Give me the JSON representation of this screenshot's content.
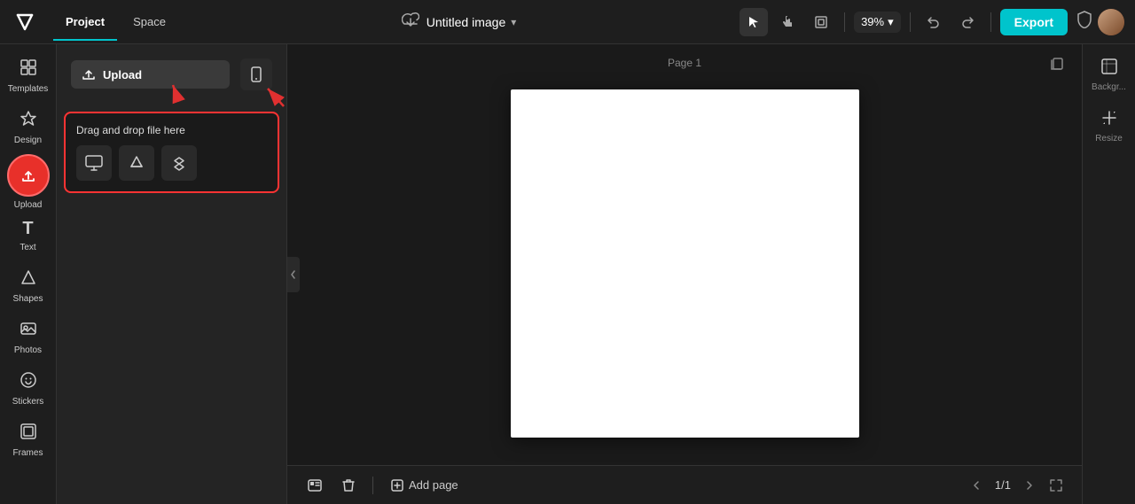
{
  "topbar": {
    "logo": "✕",
    "tabs": [
      {
        "label": "Project",
        "active": true
      },
      {
        "label": "Space",
        "active": false
      }
    ],
    "cloud_icon": "☁",
    "title": "Untitled image",
    "chevron": "▾",
    "tools": [
      {
        "name": "select",
        "icon": "↖",
        "active": true
      },
      {
        "name": "hand",
        "icon": "✋",
        "active": false
      },
      {
        "name": "frame",
        "icon": "⬜",
        "active": false
      }
    ],
    "zoom": "39%",
    "zoom_chevron": "▾",
    "undo_icon": "↩",
    "redo_icon": "↪",
    "export_label": "Export",
    "shield_icon": "🛡"
  },
  "sidebar": {
    "items": [
      {
        "label": "Templates",
        "icon": "⊞"
      },
      {
        "label": "Design",
        "icon": "✦"
      },
      {
        "label": "Upload",
        "icon": "↑",
        "active": true
      },
      {
        "label": "Text",
        "icon": "T"
      },
      {
        "label": "Shapes",
        "icon": "◇"
      },
      {
        "label": "Photos",
        "icon": "🖼"
      },
      {
        "label": "Stickers",
        "icon": "☺"
      },
      {
        "label": "Frames",
        "icon": "⬚"
      }
    ]
  },
  "panel": {
    "upload_btn_label": "Upload",
    "upload_icon": "↑",
    "phone_icon": "📱",
    "drag_drop_label": "Drag and drop file here",
    "sources": [
      {
        "name": "computer",
        "icon": "🖥"
      },
      {
        "name": "google-drive",
        "icon": "△"
      },
      {
        "name": "dropbox",
        "icon": "❑"
      }
    ]
  },
  "canvas": {
    "page_label": "Page 1",
    "page_icon": "⎘"
  },
  "bottom_bar": {
    "camera_icon": "⊡",
    "trash_icon": "🗑",
    "add_page_icon": "⊞",
    "add_page_label": "Add page",
    "page_prev": "‹",
    "page_counter": "1/1",
    "page_next": "›",
    "fit_icon": "⊡"
  },
  "right_sidebar": {
    "items": [
      {
        "label": "Backgr...",
        "icon": "⊞"
      },
      {
        "label": "Resize",
        "icon": "⤢"
      }
    ]
  }
}
